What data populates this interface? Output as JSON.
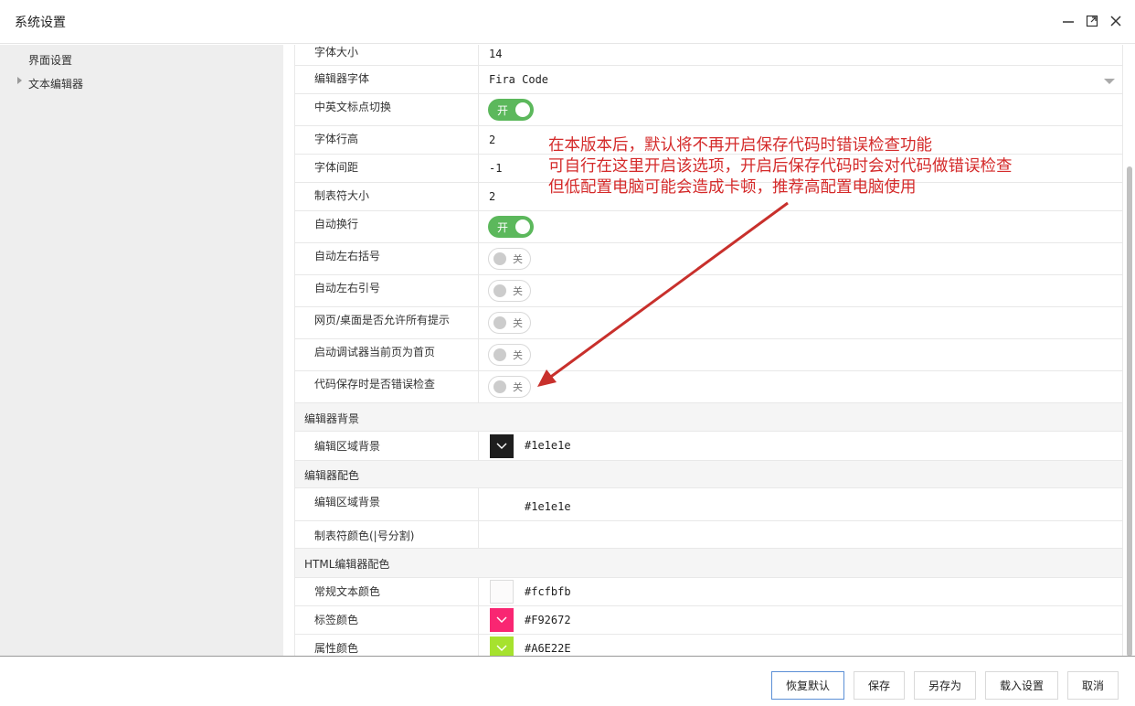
{
  "window": {
    "title": "系统设置"
  },
  "sidebar": {
    "items": [
      {
        "label": "界面设置"
      },
      {
        "label": "文本编辑器"
      }
    ]
  },
  "settings": {
    "font_size": {
      "label": "字体大小",
      "value": "14"
    },
    "editor_font": {
      "label": "编辑器字体",
      "value": "Fira Code"
    },
    "punct_switch": {
      "label": "中英文标点切换",
      "state": "开"
    },
    "line_height": {
      "label": "字体行高",
      "value": "2"
    },
    "letter_spacing": {
      "label": "字体间距",
      "value": "-1"
    },
    "tab_size": {
      "label": "制表符大小",
      "value": "2"
    },
    "word_wrap": {
      "label": "自动换行",
      "state": "开"
    },
    "auto_brackets": {
      "label": "自动左右括号",
      "state": "关"
    },
    "auto_quotes": {
      "label": "自动左右引号",
      "state": "关"
    },
    "web_hints": {
      "label": "网页/桌面是否允许所有提示",
      "state": "关"
    },
    "debugger_home": {
      "label": "启动调试器当前页为首页",
      "state": "关"
    },
    "save_check": {
      "label": "代码保存时是否错误检查",
      "state": "关"
    }
  },
  "sections": {
    "editor_bg": {
      "title": "编辑器背景",
      "area_bg": {
        "label": "编辑区域背景",
        "value": "#1e1e1e",
        "color": "#1e1e1e"
      }
    },
    "editor_colors": {
      "title": "编辑器配色",
      "area_bg": {
        "label": "编辑区域背景",
        "value": "#1e1e1e"
      },
      "tab_color": {
        "label": "制表符颜色(|号分割)",
        "value": ""
      }
    },
    "html_colors": {
      "title": "HTML编辑器配色",
      "normal_text": {
        "label": "常规文本颜色",
        "value": "#fcfbfb",
        "color": "#fcfbfb"
      },
      "tag_color": {
        "label": "标签颜色",
        "value": "#F92672",
        "color": "#F92672"
      },
      "attr_color": {
        "label": "属性颜色",
        "value": "#A6E22E",
        "color": "#A6E22E"
      }
    }
  },
  "annotation": {
    "lines": [
      "在本版本后，默认将不再开启保存代码时错误检查功能",
      "可自行在这里开启该选项，开启后保存代码时会对代码做错误检查",
      "但低配置电脑可能会造成卡顿，推荐高配置电脑使用"
    ],
    "color": "#d42a2a"
  },
  "footer": {
    "restore": "恢复默认",
    "save": "保存",
    "save_as": "另存为",
    "load": "载入设置",
    "cancel": "取消"
  }
}
